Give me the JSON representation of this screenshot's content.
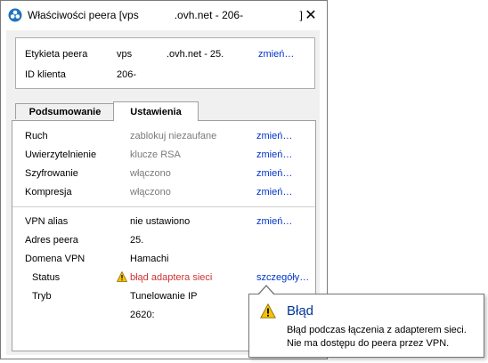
{
  "window": {
    "title": "Właściwości peera [vps            .ovh.net - 206-                   ]",
    "close_glyph": "✕"
  },
  "info": {
    "peer_label": "Etykieta peera",
    "peer_value_left": "vps",
    "peer_value_right": ".ovh.net - 25.",
    "peer_change": "zmień…",
    "client_id_label": "ID klienta",
    "client_id_value": "206-"
  },
  "tabs": [
    {
      "label": "Podsumowanie",
      "active": false
    },
    {
      "label": "Ustawienia",
      "active": true
    }
  ],
  "settings": [
    {
      "label": "Ruch",
      "value": "zablokuj niezaufane",
      "action": "zmień…"
    },
    {
      "label": "Uwierzytelnienie",
      "value": "klucze RSA",
      "action": "zmień…"
    },
    {
      "label": "Szyfrowanie",
      "value": "włączono",
      "action": "zmień…"
    },
    {
      "label": "Kompresja",
      "value": "włączono",
      "action": "zmień…"
    }
  ],
  "vpn": {
    "alias_label": "VPN alias",
    "alias_value": "nie ustawiono",
    "alias_action": "zmień…",
    "address_label": "Adres peera",
    "address_value": "25.",
    "domain_label": "Domena VPN",
    "domain_value": "Hamachi",
    "status_label": "Status",
    "status_value": "błąd adaptera sieci",
    "status_action": "szczegóły…",
    "mode_label": "Tryb",
    "mode_value": "Tunelowanie IP",
    "ipv6_value": "2620:"
  },
  "tooltip": {
    "title": "Błąd",
    "line1": "Błąd podczas łączenia z adapterem sieci.",
    "line2": "Nie ma dostępu do peera przez VPN."
  },
  "colors": {
    "link": "#0033cc",
    "error": "#cc3333",
    "tooltip_title": "#003399",
    "warning": "#f5c400"
  }
}
